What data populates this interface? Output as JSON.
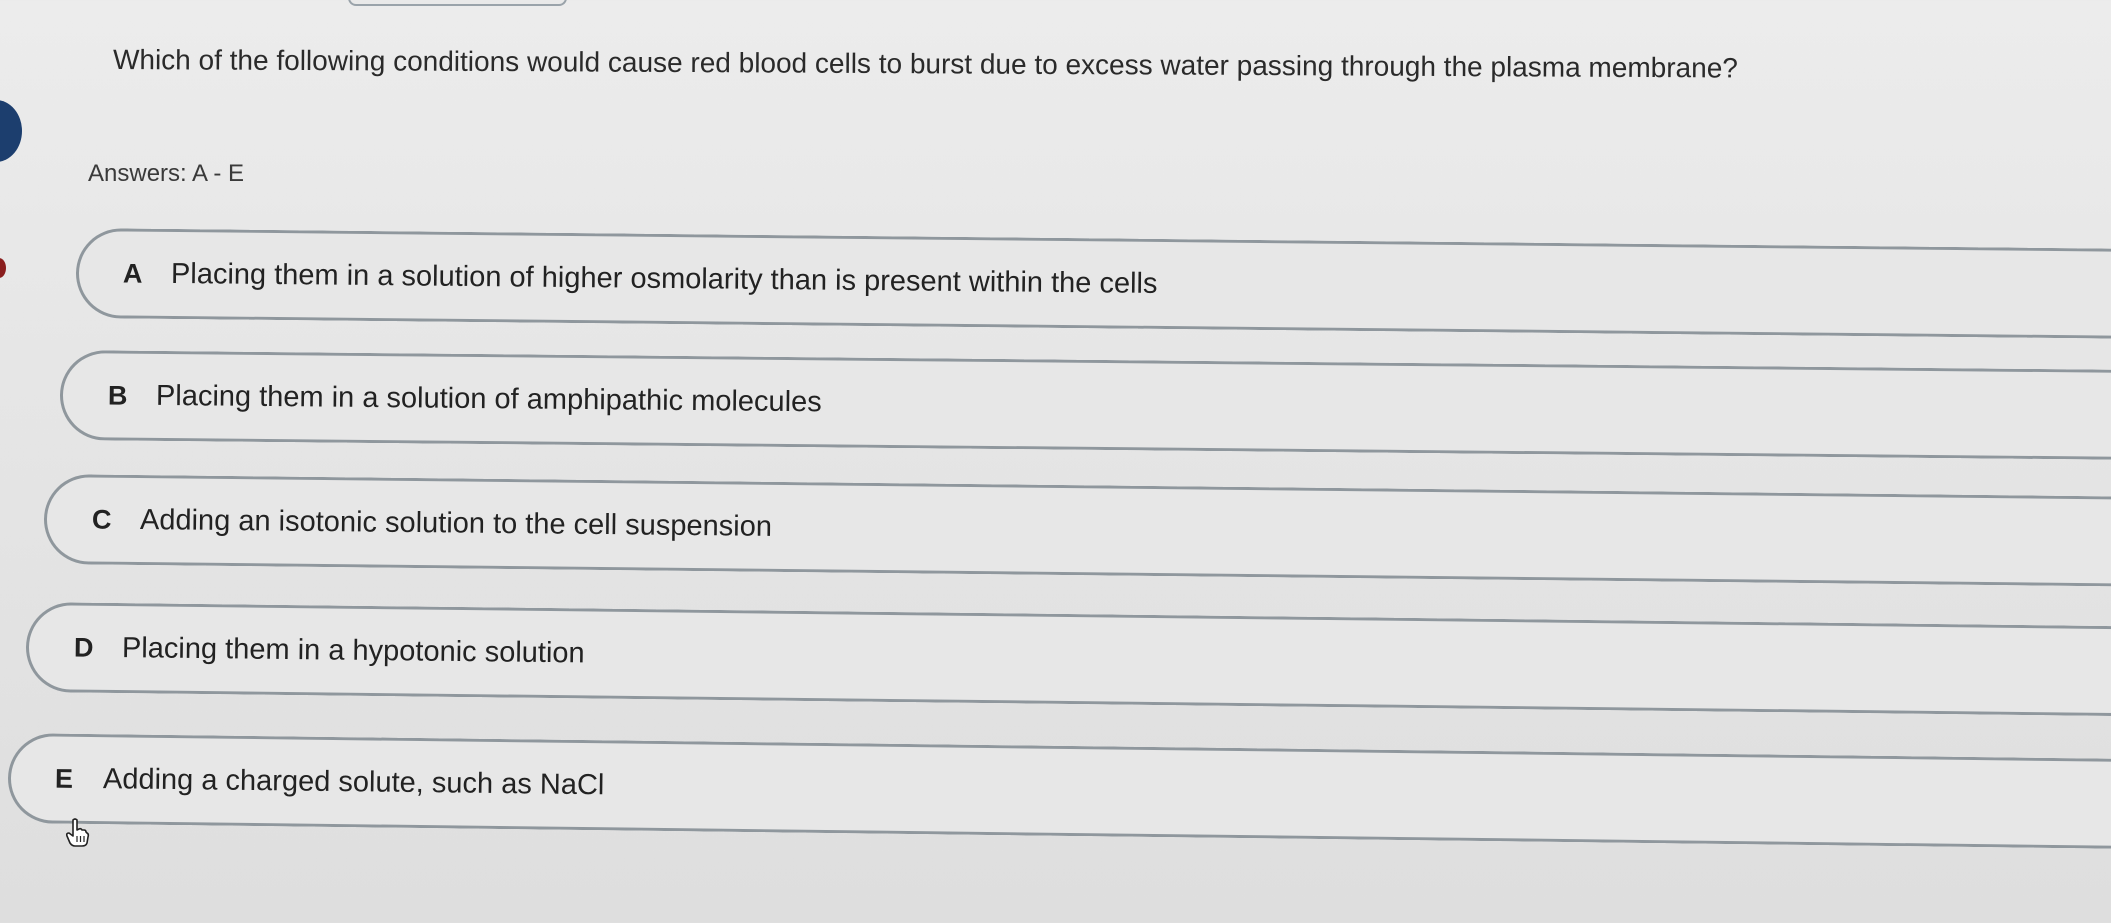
{
  "question": "Which of the following conditions would cause red blood cells to burst due to excess water passing through the plasma membrane?",
  "answers_label": "Answers: A - E",
  "options": [
    {
      "letter": "A",
      "text": "Placing them in a solution of higher osmolarity than is present within the cells"
    },
    {
      "letter": "B",
      "text": "Placing them in a solution of amphipathic molecules"
    },
    {
      "letter": "C",
      "text": "Adding an isotonic solution to the cell suspension"
    },
    {
      "letter": "D",
      "text": "Placing them in a hypotonic solution"
    },
    {
      "letter": "E",
      "text": "Adding a charged solute, such as NaCl"
    }
  ],
  "colors": {
    "background": "#e6e6e6",
    "option_border": "#8f979d",
    "text": "#222222",
    "left_badge": "#1c3e6e"
  },
  "icons": [
    "hand-pointer-icon"
  ]
}
